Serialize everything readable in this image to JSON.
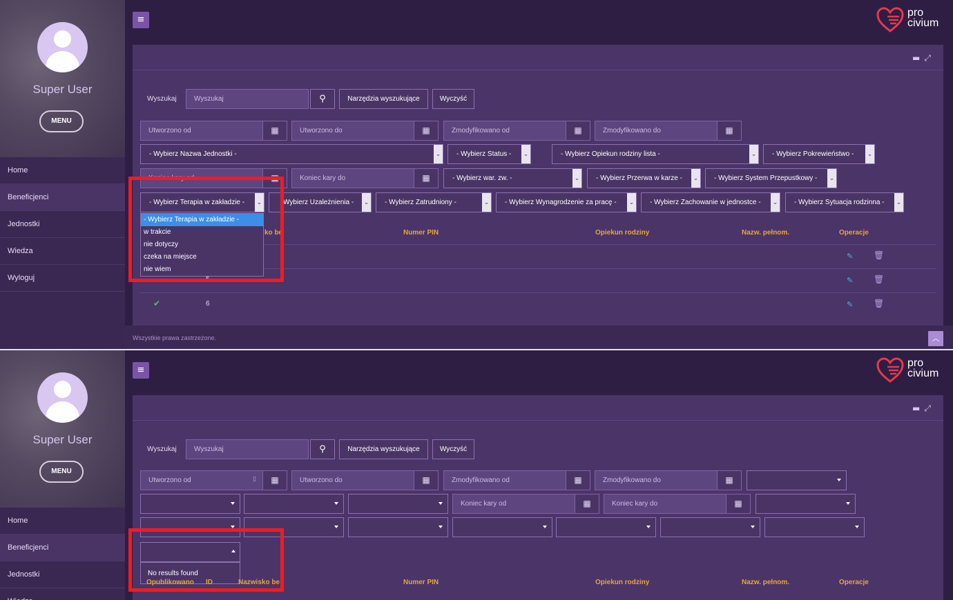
{
  "colors": {
    "accent": "#7a54a8",
    "panel": "#4b3468",
    "header_text": "#e6a63a",
    "highlight": "#3d8fe6",
    "annotation": "#ef1c24"
  },
  "sidebar": {
    "user_name": "Super User",
    "menu_label": "MENU",
    "items": [
      {
        "label": "Home"
      },
      {
        "label": "Beneficjenci"
      },
      {
        "label": "Jednostki"
      },
      {
        "label": "Wiedza"
      },
      {
        "label": "Wyloguj"
      }
    ]
  },
  "logo": {
    "line1": "pro",
    "line2": "civium"
  },
  "search": {
    "label": "Wyszukaj",
    "placeholder": "Wyszukaj",
    "tools_button": "Narzędzia wyszukujące",
    "clear_button": "Wyczyść"
  },
  "dates": {
    "created_from": "Utworzono od",
    "created_to": "Utworzono do",
    "modified_from": "Zmodyfikowano od",
    "modified_to": "Zmodyfikowano do",
    "penalty_end_from": "Koniec kary od",
    "penalty_end_to": "Koniec kary do"
  },
  "selects": {
    "unit_name": "- Wybierz Nazwa Jednostki -",
    "status": "- Wybierz Status -",
    "family_guardian": "- Wybierz Opiekun rodziny lista -",
    "kinship": "- Wybierz Pokrewieństwo -",
    "war_zw": "- Wybierz war. zw. -",
    "penalty_break": "- Wybierz Przerwa w karze -",
    "pass_system": "- Wybierz System Przepustkowy -",
    "therapy": "- Wybierz Terapia w zakładzie -",
    "addiction": "Wybierz Uzależnienia -",
    "employed": "- Wybierz Zatrudniony -",
    "salary": "- Wybierz Wynagrodzenie za pracę -",
    "behavior": "- Wybierz Zachowanie w jednostce -",
    "family_situation": "- Wybierz Sytuacja rodzinna -"
  },
  "dropdown": {
    "options": [
      "- Wybierz Terapia w zakładzie -",
      "w trakcie",
      "nie dotyczy",
      "czeka na miejsce",
      "nie wiem"
    ],
    "selected_index": 0,
    "no_results": "No results found"
  },
  "table": {
    "headers": [
      "ko be",
      "Numer PIN",
      "Opiekun rodziny",
      "Nazw. pełnom.",
      "Operacje"
    ],
    "headers_p2": [
      "Opublikowano",
      "ID",
      "Nazwisko be",
      "Numer PIN",
      "Opiekun rodziny",
      "Nazw. pełnom.",
      "Operacje"
    ],
    "rows": [
      {
        "id": ""
      },
      {
        "id": "5"
      },
      {
        "id": "6"
      }
    ]
  },
  "footer": {
    "text": "Wszystkie prawa zastrzeżone."
  },
  "icons": {
    "hamburger": "≡",
    "calendar": "▦",
    "search": "⚲",
    "edit": "✎",
    "trash": "🗑",
    "check": "✔",
    "up": "︿"
  }
}
